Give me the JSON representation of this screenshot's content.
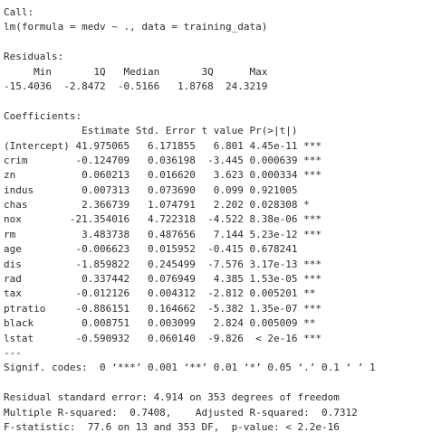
{
  "console": {
    "lines": [
      "Call:",
      "lm(formula = medv ~ ., data = training_data)",
      "",
      "Residuals:",
      "     Min       1Q   Median       3Q      Max ",
      "-15.4036  -2.8472  -0.5166   1.8768  24.3219 ",
      "",
      "Coefficients:",
      "             Estimate Std. Error t value Pr(>|t|)    ",
      "(Intercept) 41.975065   6.171855   6.801 4.45e-11 ***",
      "crim        -0.124709   0.036198  -3.445 0.000639 ***",
      "zn           0.060213   0.016620   3.623 0.000334 ***",
      "indus        0.007313   0.073690   0.099 0.921005    ",
      "chas         2.366739   1.074791   2.202 0.028308 *  ",
      "nox        -21.354016   4.722318  -4.522 8.38e-06 ***",
      "rm           3.483738   0.487656   7.144 5.23e-12 ***",
      "age         -0.006623   0.015952  -0.415 0.678241    ",
      "dis         -1.859822   0.245499  -7.576 3.17e-13 ***",
      "rad          0.337442   0.076949   4.385 1.53e-05 ***",
      "tax         -0.012126   0.004312  -2.812 0.005201 ** ",
      "ptratio     -0.886151   0.164662  -5.382 1.35e-07 ***",
      "black        0.008751   0.003099   2.824 0.005009 ** ",
      "lstat       -0.590932   0.060140  -9.826  < 2e-16 ***",
      "---",
      "Signif. codes:  0 ‘***’ 0.001 ‘**’ 0.01 ‘*’ 0.05 ‘.’ 0.1 ‘ ’ 1",
      "",
      "Residual standard error: 4.914 on 353 degrees of freedom",
      "Multiple R-squared:  0.7408,\tAdjusted R-squared:  0.7312 ",
      "F-statistic:  77.6 on 13 and 353 DF,  p-value: < 2.2e-16"
    ]
  }
}
